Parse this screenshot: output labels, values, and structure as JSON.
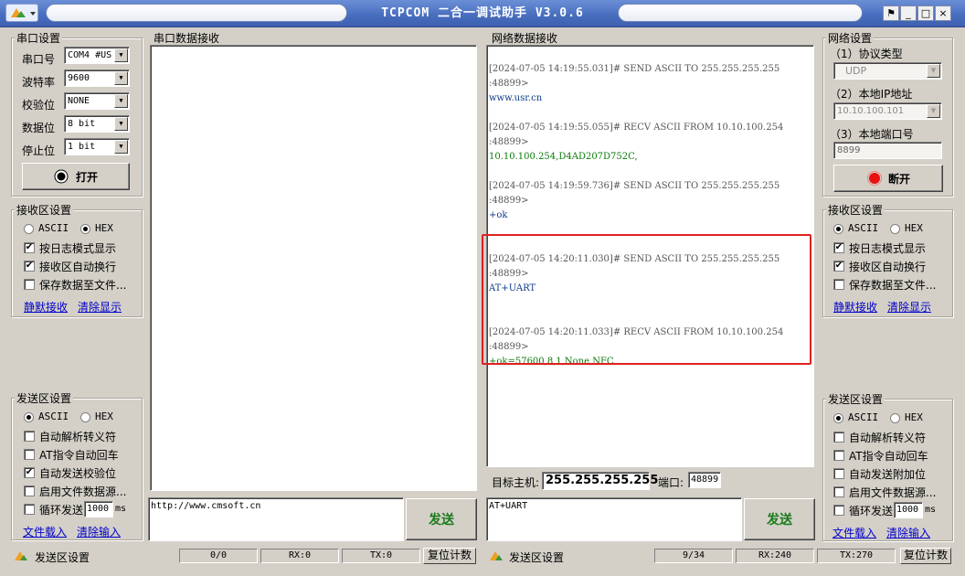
{
  "window": {
    "title": "TCPCOM  二合一调试助手  V3.0.6",
    "minimize_glyph": "_",
    "maximize_glyph": "□",
    "close_glyph": "×",
    "pin_glyph": "⚑"
  },
  "serial_settings": {
    "title": "串口设置",
    "port_label": "串口号",
    "port_value": "COM4 #US",
    "baud_label": "波特率",
    "baud_value": "9600",
    "parity_label": "校验位",
    "parity_value": "NONE",
    "databits_label": "数据位",
    "databits_value": "8 bit",
    "stopbits_label": "停止位",
    "stopbits_value": "1 bit",
    "open_button": "打开"
  },
  "left_recv_settings": {
    "title": "接收区设置",
    "ascii": "ASCII",
    "hex": "HEX",
    "log_mode": "按日志模式显示",
    "auto_wrap": "接收区自动换行",
    "save_file": "保存数据至文件...",
    "silent_recv": "静默接收",
    "clear_display": "清除显示"
  },
  "left_send_settings": {
    "title": "发送区设置",
    "ascii": "ASCII",
    "hex": "HEX",
    "auto_escape": "自动解析转义符",
    "at_crlf": "AT指令自动回车",
    "auto_checksum": "自动发送校验位",
    "file_source": "启用文件数据源...",
    "loop_send": "循环发送",
    "loop_value": "1000",
    "loop_unit": "ms",
    "file_load": "文件载入",
    "clear_input": "清除输入"
  },
  "serial_recv": {
    "title": "串口数据接收"
  },
  "serial_send": {
    "value": "http://www.cmsoft.cn",
    "send_button": "发送"
  },
  "serial_status": {
    "label": "发送区设置",
    "count": "0/0",
    "rx": "RX:0",
    "tx": "TX:0",
    "reset": "复位计数"
  },
  "net_recv": {
    "title": "网络数据接收",
    "log": [
      {
        "hdr": "[2024-07-05 14:19:55.031]# SEND ASCII TO 255.255.255.255",
        "port": ":48899>",
        "msg": "www.usr.cn",
        "kind": "send"
      },
      {
        "hdr": "[2024-07-05 14:19:55.055]# RECV ASCII FROM 10.10.100.254",
        "port": ":48899>",
        "msg": "10.10.100.254,D4AD207D752C,",
        "kind": "recv"
      },
      {
        "hdr": "[2024-07-05 14:19:59.736]# SEND ASCII TO 255.255.255.255",
        "port": ":48899>",
        "msg": "+ok",
        "kind": "send"
      },
      {
        "hdr": "[2024-07-05 14:20:11.030]# SEND ASCII TO 255.255.255.255",
        "port": ":48899>",
        "msg": "AT+UART",
        "kind": "send"
      },
      {
        "hdr": "[2024-07-05 14:20:11.033]# RECV ASCII FROM 10.10.100.254",
        "port": ":48899>",
        "msg": "+ok=57600,8,1,None,NFC",
        "kind": "recv"
      }
    ],
    "highlight_color": "#e02020"
  },
  "target": {
    "host_label": "目标主机:",
    "host_value": "255.255.255.255",
    "port_label": "端口:",
    "port_value": "48899"
  },
  "net_send": {
    "value": "AT+UART",
    "send_button": "发送"
  },
  "net_status": {
    "label": "发送区设置",
    "count": "9/34",
    "rx": "RX:240",
    "tx": "TX:270",
    "reset": "复位计数"
  },
  "net_settings": {
    "title": "网络设置",
    "protocol_label": "（1）协议类型",
    "protocol_value": "UDP",
    "local_ip_label": "（2）本地IP地址",
    "local_ip_value": "10.10.100.101",
    "local_port_label": "（3）本地端口号",
    "local_port_value": "8899",
    "disconnect_button": "断开"
  },
  "right_recv_settings": {
    "title": "接收区设置",
    "ascii": "ASCII",
    "hex": "HEX",
    "log_mode": "按日志模式显示",
    "auto_wrap": "接收区自动换行",
    "save_file": "保存数据至文件...",
    "silent_recv": "静默接收",
    "clear_display": "清除显示"
  },
  "right_send_settings": {
    "title": "发送区设置",
    "ascii": "ASCII",
    "hex": "HEX",
    "auto_escape": "自动解析转义符",
    "at_crlf": "AT指令自动回车",
    "auto_append": "自动发送附加位",
    "file_source": "启用文件数据源...",
    "loop_send": "循环发送",
    "loop_value": "1000",
    "loop_unit": "ms",
    "file_load": "文件载入",
    "clear_input": "清除输入"
  }
}
